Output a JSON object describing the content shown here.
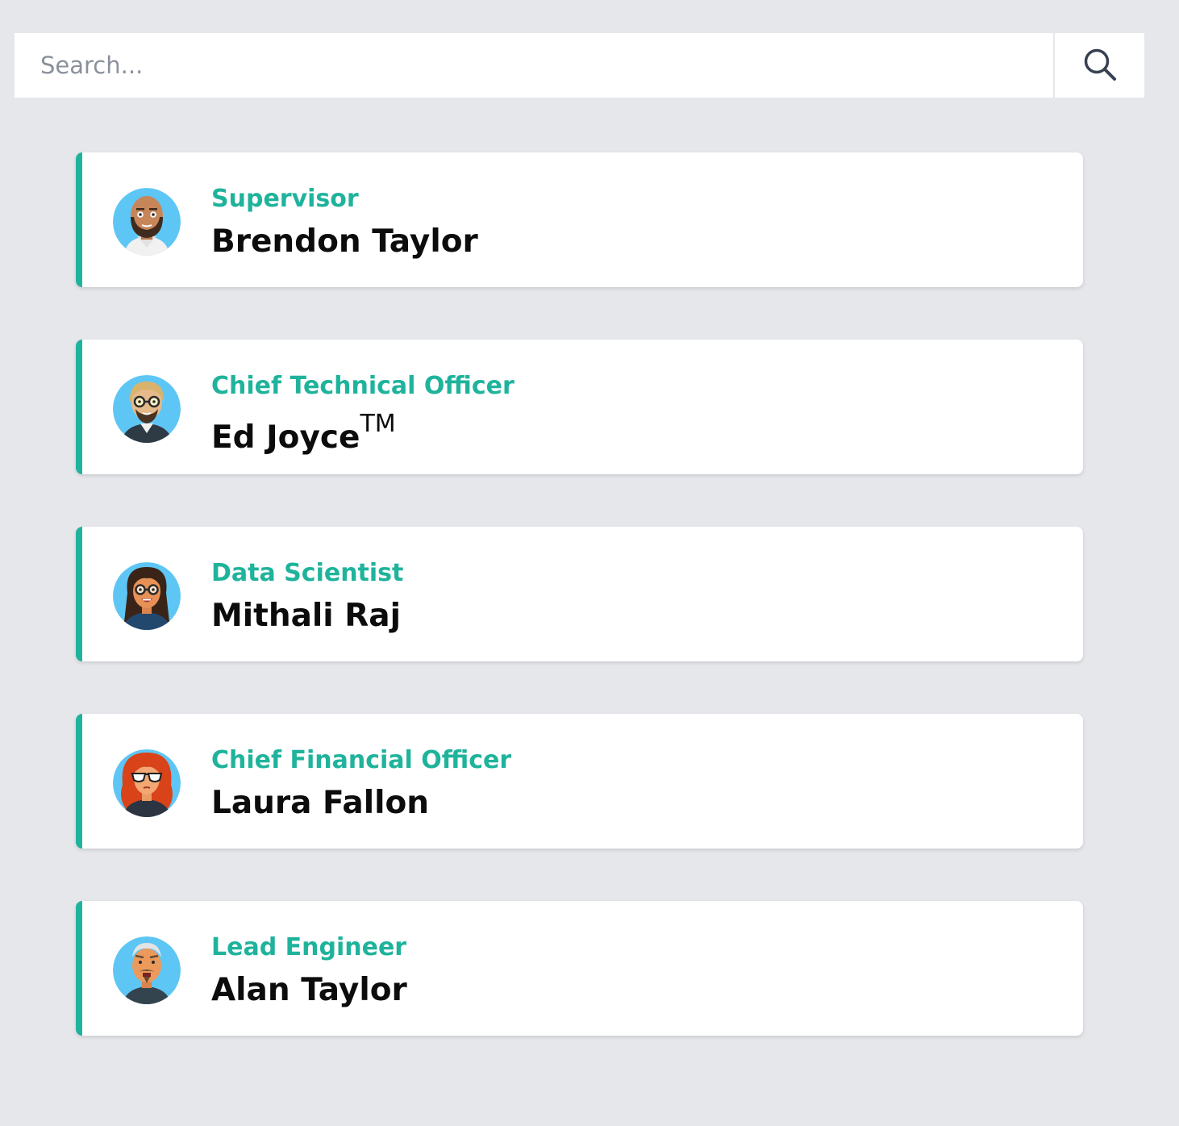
{
  "search": {
    "placeholder": "Search...",
    "value": "",
    "button_icon": "search-icon"
  },
  "colors": {
    "accent": "#1fb39c",
    "background": "#e5e7eb",
    "card": "#ffffff",
    "avatar_bg": "#5ec6f5"
  },
  "people": [
    {
      "role": "Supervisor",
      "name": "Brendon Taylor",
      "trademark": "",
      "avatar": "bald-bearded-man-avatar"
    },
    {
      "role": "Chief Technical Officer",
      "name": "Ed Joyce",
      "trademark": "TM",
      "avatar": "blond-man-glasses-avatar"
    },
    {
      "role": "Data Scientist",
      "name": "Mithali Raj",
      "trademark": "",
      "avatar": "woman-glasses-avatar"
    },
    {
      "role": "Chief Financial Officer",
      "name": "Laura Fallon",
      "trademark": "",
      "avatar": "redhead-woman-sunglasses-avatar"
    },
    {
      "role": "Lead Engineer",
      "name": "Alan Taylor",
      "trademark": "",
      "avatar": "older-man-mustache-avatar"
    }
  ]
}
